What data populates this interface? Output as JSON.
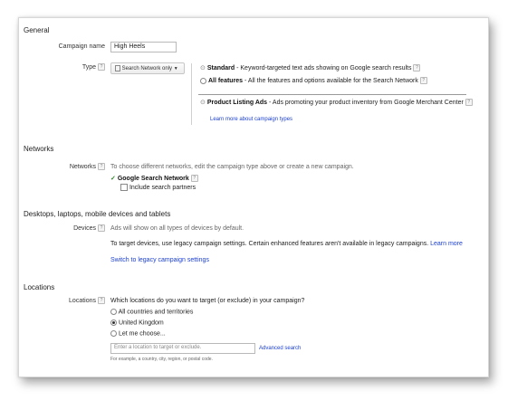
{
  "general": {
    "heading": "General",
    "campaign_name_label": "Campaign name",
    "campaign_name_value": "High Heels",
    "type_label": "Type",
    "type_dropdown": "Search Network only",
    "options": [
      {
        "title": "Standard",
        "desc": " - Keyword-targeted text ads showing on Google search results"
      },
      {
        "title": "All features",
        "desc": " - All the features and options available for the Search Network"
      },
      {
        "title": "Product Listing Ads",
        "desc": " - Ads promoting your product inventory from Google Merchant Center"
      }
    ],
    "learn_more": "Learn more about campaign types"
  },
  "networks": {
    "heading": "Networks",
    "label": "Networks",
    "description": "To choose different networks, edit the campaign type above or create a new campaign.",
    "network_name": "Google Search Network",
    "include_partners": "Include search partners"
  },
  "devices": {
    "heading": "Desktops, laptops, mobile devices and tablets",
    "label": "Devices",
    "description": "Ads will show on all types of devices by default.",
    "legacy_text": "To target devices, use legacy campaign settings. Certain enhanced features aren't available in legacy campaigns.",
    "learn_more": "Learn more",
    "switch_link": "Switch to legacy campaign settings"
  },
  "locations": {
    "heading": "Locations",
    "label": "Locations",
    "question": "Which locations do you want to target (or exclude) in your campaign?",
    "options": [
      "All countries and territories",
      "United Kingdom",
      "Let me choose..."
    ],
    "selected_index": 1,
    "input_placeholder": "Enter a location to target or exclude.",
    "advanced_search": "Advanced search",
    "hint": "For example, a country, city, region, or postal code."
  },
  "icons": {
    "help": "?",
    "check": "✓",
    "pin": "⊙"
  }
}
